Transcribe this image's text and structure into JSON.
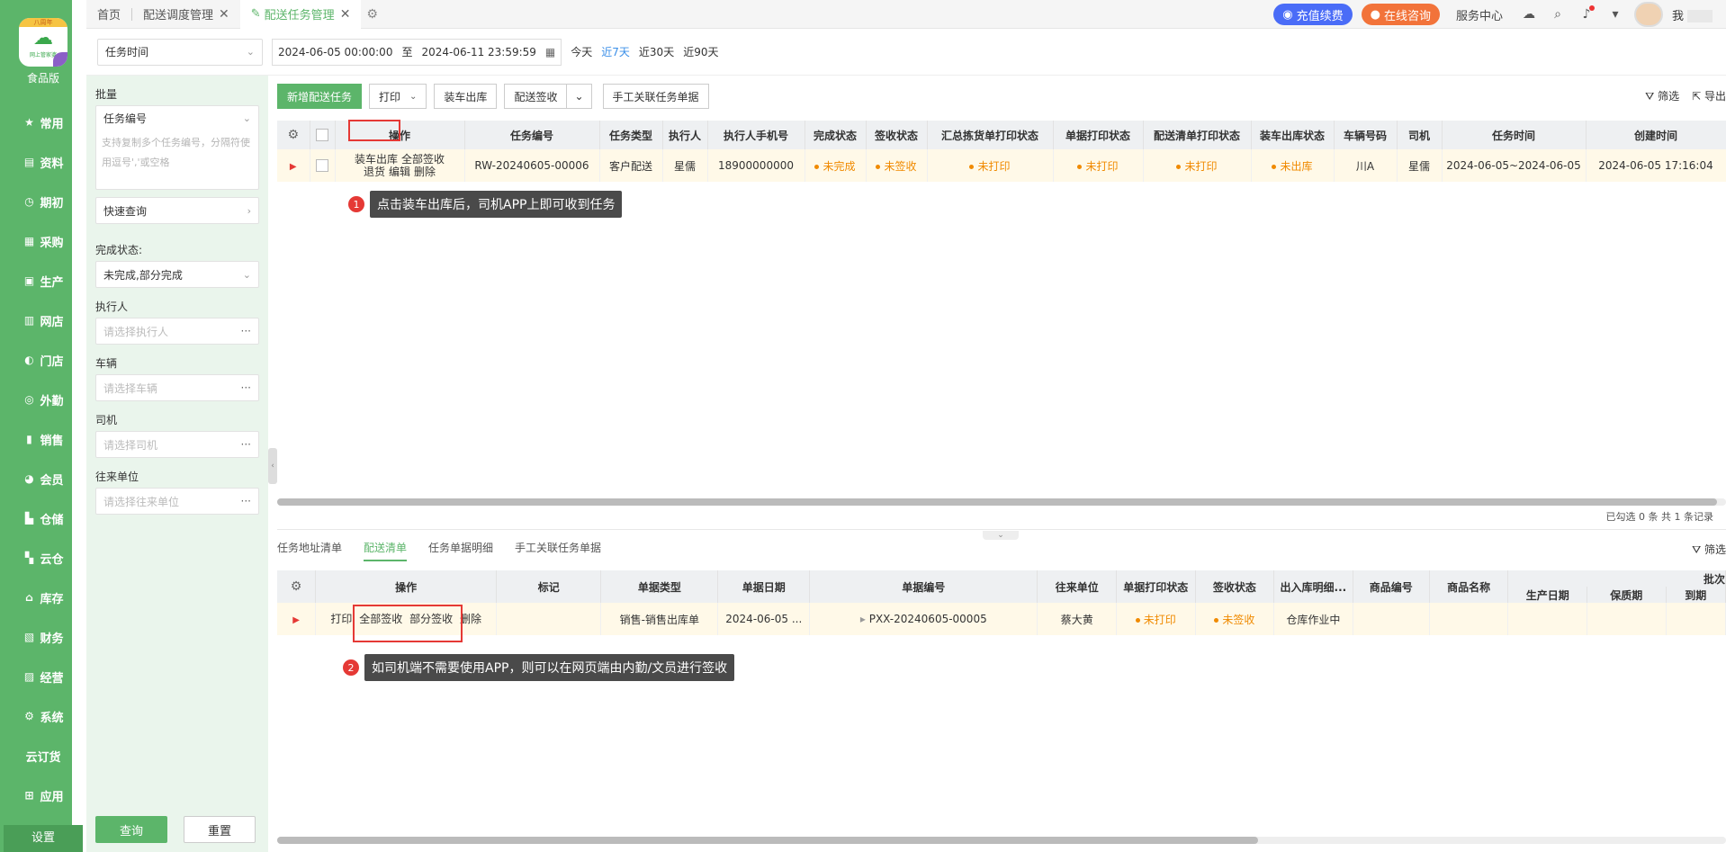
{
  "nav": {
    "logo": {
      "badge": "八周年",
      "sub": "网上管家婆"
    },
    "edition": "食品版",
    "items": [
      {
        "label": "常用",
        "icon": "star-icon"
      },
      {
        "label": "资料",
        "icon": "document-icon"
      },
      {
        "label": "期初",
        "icon": "clock-icon"
      },
      {
        "label": "采购",
        "icon": "cart-icon"
      },
      {
        "label": "生产",
        "icon": "factory-icon"
      },
      {
        "label": "网店",
        "icon": "shop-icon"
      },
      {
        "label": "门店",
        "icon": "store-icon"
      },
      {
        "label": "外勤",
        "icon": "location-icon"
      },
      {
        "label": "销售",
        "icon": "chart-icon"
      },
      {
        "label": "会员",
        "icon": "pie-icon"
      },
      {
        "label": "仓储",
        "icon": "warehouse-icon"
      },
      {
        "label": "云仓",
        "icon": "cloud-warehouse-icon"
      },
      {
        "label": "库存",
        "icon": "home-icon"
      },
      {
        "label": "财务",
        "icon": "finance-icon"
      },
      {
        "label": "经营",
        "icon": "trend-icon"
      },
      {
        "label": "系统",
        "icon": "gear-icon"
      },
      {
        "label": "云订货",
        "icon": ""
      },
      {
        "label": "应用",
        "icon": "plus-icon"
      }
    ],
    "settings": "设置"
  },
  "tabs": [
    {
      "label": "首页"
    },
    {
      "label": "配送调度管理"
    },
    {
      "label": "配送任务管理"
    }
  ],
  "topright": {
    "recharge": "充值续费",
    "consult": "在线咨询",
    "service": "服务中心",
    "user": "我"
  },
  "filter": {
    "time_type": "任务时间",
    "date_from": "2024-06-05 00:00:00",
    "date_sep": "至",
    "date_to": "2024-06-11 23:59:59",
    "quick": [
      "今天",
      "近7天",
      "近30天",
      "近90天"
    ],
    "quick_active": 1
  },
  "side": {
    "batch_label": "批量",
    "batch_field": "任务编号",
    "batch_placeholder": "支持复制多个任务编号，分隔符使用逗号','或空格",
    "quick_query": "快速查询",
    "status_label": "完成状态:",
    "status_value": "未完成,部分完成",
    "executor_label": "执行人",
    "executor_ph": "请选择执行人",
    "vehicle_label": "车辆",
    "vehicle_ph": "请选择车辆",
    "driver_label": "司机",
    "driver_ph": "请选择司机",
    "partner_label": "往来单位",
    "partner_ph": "请选择往来单位",
    "query_btn": "查询",
    "reset_btn": "重置"
  },
  "toolbar": {
    "new_task": "新增配送任务",
    "print": "打印",
    "load_out": "装车出库",
    "sign": "配送签收",
    "manual_link": "手工关联任务单据",
    "filter": "筛选",
    "export": "导出"
  },
  "grid": {
    "headers": [
      "操作",
      "任务编号",
      "任务类型",
      "执行人",
      "执行人手机号",
      "完成状态",
      "签收状态",
      "汇总拣货单打印状态",
      "单据打印状态",
      "配送清单打印状态",
      "装车出库状态",
      "车辆号码",
      "司机",
      "任务时间",
      "创建时间"
    ],
    "row": {
      "ops_line1": [
        "装车出库",
        "全部签收"
      ],
      "ops_line2": [
        "退货",
        "编辑",
        "删除"
      ],
      "task_no": "RW-20240605-00006",
      "task_type": "客户配送",
      "executor": "星儒",
      "phone": "18900000000",
      "complete": "未完成",
      "sign": "未签收",
      "pick_print": "未打印",
      "doc_print": "未打印",
      "list_print": "未打印",
      "load_status": "未出库",
      "vehicle": "川A",
      "driver": "星儒",
      "task_time": "2024-06-05~2024-06-05",
      "created": "2024-06-05 17:16:04"
    },
    "summary": "已勾选 0 条 共 1 条记录"
  },
  "callouts": {
    "c1_num": "1",
    "c1_text": "点击装车出库后，司机APP上即可收到任务",
    "c2_num": "2",
    "c2_text": "如司机端不需要使用APP，则可以在网页端由内勤/文员进行签收"
  },
  "subtabs": [
    "任务地址清单",
    "配送清单",
    "任务单据明细",
    "手工关联任务单据"
  ],
  "subtab_active": 1,
  "subtab_filter": "筛选",
  "grid2": {
    "headers": [
      "操作",
      "标记",
      "单据类型",
      "单据日期",
      "单据编号",
      "往来单位",
      "单据打印状态",
      "签收状态",
      "出入库明细...",
      "商品编号",
      "商品名称"
    ],
    "group_header": "批次",
    "sub_headers": [
      "生产日期",
      "保质期",
      "到期"
    ],
    "row": {
      "ops": [
        "打印",
        "全部签收",
        "部分签收",
        "删除"
      ],
      "doc_type": "销售-销售出库单",
      "doc_date": "2024-06-05 ...",
      "doc_no": "PXX-20240605-00005",
      "partner": "蔡大黄",
      "print": "未打印",
      "sign": "未签收",
      "io": "仓库作业中"
    }
  }
}
